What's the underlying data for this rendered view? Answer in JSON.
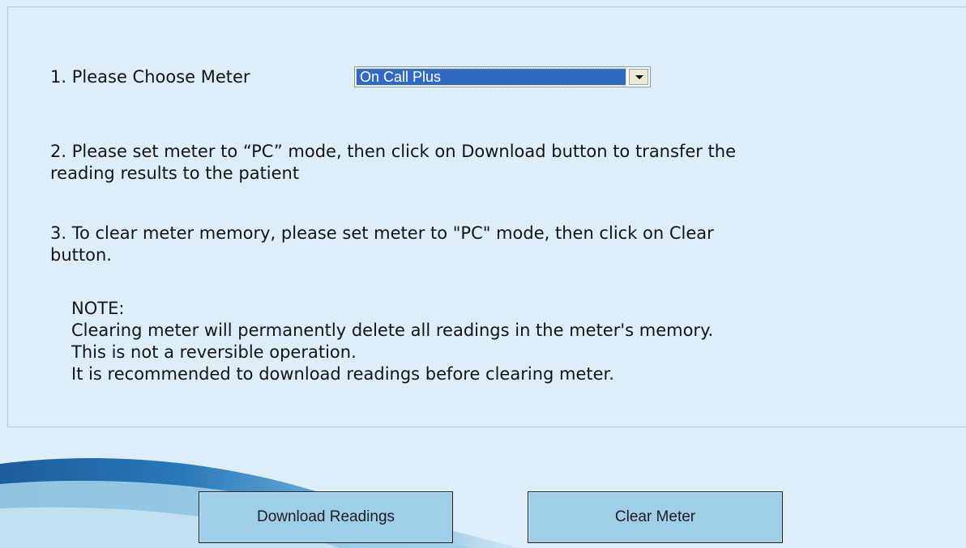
{
  "steps": {
    "step1_label": "1. Please Choose Meter",
    "step2_line1": "2. Please set meter to “PC” mode, then click on Download button to transfer the",
    "step2_line2": "reading results to the patient",
    "step3_line1": "3. To clear meter memory, please set meter to \"PC\" mode, then click on Clear",
    "step3_line2": "button."
  },
  "meter_select": {
    "selected": "On Call Plus",
    "arrow_icon": "chevron-down-icon"
  },
  "note": {
    "heading": "NOTE:",
    "lines": [
      "Clearing meter will permanently delete all readings in the meter's memory.",
      "This is not a reversible operation.",
      "It is recommended to download readings before clearing meter."
    ]
  },
  "buttons": {
    "download_label": "Download Readings",
    "clear_label": "Clear Meter"
  },
  "colors": {
    "background": "#ddeef8",
    "select_highlight": "#316ac5",
    "button_fill": "#9fcfe8",
    "wave_dark": "#1e5f9e"
  }
}
